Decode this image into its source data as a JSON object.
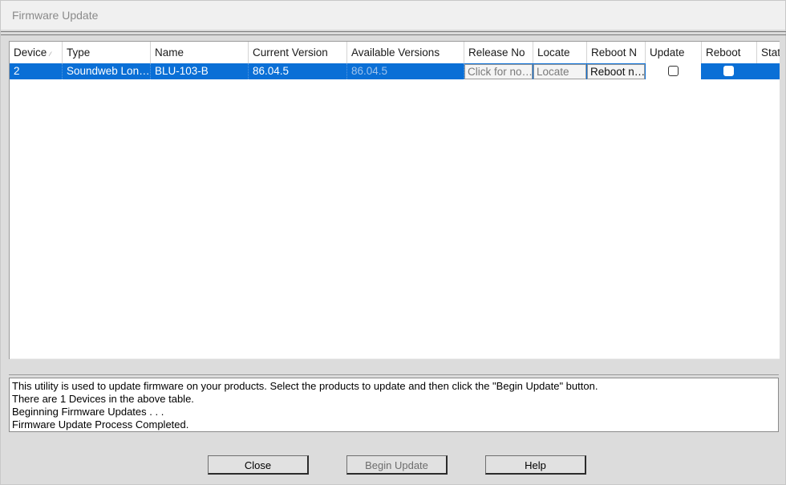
{
  "window": {
    "title": "Firmware Update"
  },
  "grid": {
    "columns": [
      {
        "label": "Device"
      },
      {
        "label": "Type"
      },
      {
        "label": "Name"
      },
      {
        "label": "Current Version"
      },
      {
        "label": "Available Versions"
      },
      {
        "label": "Release No"
      },
      {
        "label": "Locate"
      },
      {
        "label": "Reboot N"
      },
      {
        "label": "Update"
      },
      {
        "label": "Reboot"
      },
      {
        "label": "Stat"
      }
    ],
    "rows": [
      {
        "device": "2",
        "type": "Soundweb Lon…",
        "name": "BLU-103-B",
        "current_version": "86.04.5",
        "available_versions": "86.04.5",
        "release_notes": "Click for no…",
        "locate": "Locate",
        "reboot_now": "Reboot n…",
        "update_checked": false,
        "reboot_checked": false
      }
    ]
  },
  "log": [
    "This utility is used to update firmware on your products. Select the products to update and then click the \"Begin Update\" button.",
    "There are 1 Devices in the above table.",
    "Beginning Firmware Updates . . .",
    "Firmware Update Process Completed."
  ],
  "buttons": {
    "close": "Close",
    "begin_update": "Begin Update",
    "help": "Help"
  },
  "colors": {
    "selection": "#0a6fd6",
    "dialog_bg": "#dcdcdc"
  }
}
